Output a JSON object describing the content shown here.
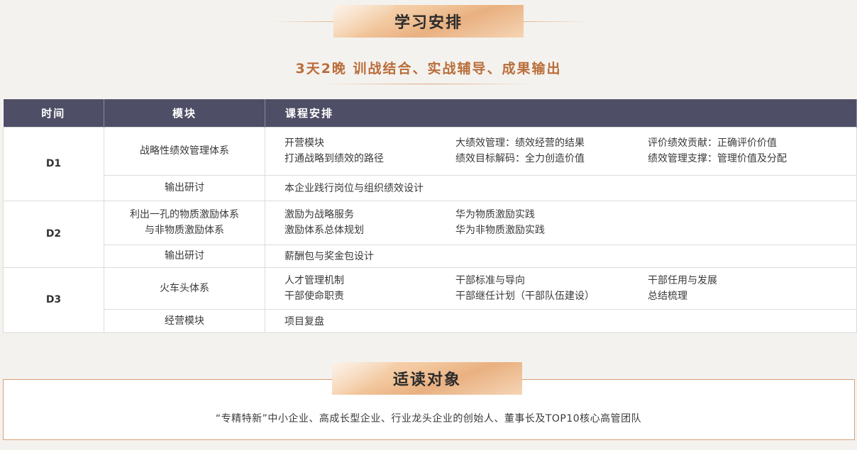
{
  "arrangement": {
    "title": "学习安排",
    "subtitle": "3天2晚 训战结合、实战辅导、成果输出"
  },
  "table": {
    "headers": {
      "time": "时间",
      "module": "模块",
      "course": "课程安排"
    },
    "days": [
      {
        "label": "D1",
        "rows": [
          {
            "module": [
              "战略性绩效管理体系"
            ],
            "items": [
              "开营模块",
              "大绩效管理：绩效经营的结果",
              "评价绩效贡献：正确评价价值",
              "打通战略到绩效的路径",
              "绩效目标解码：全力创造价值",
              "绩效管理支撑：管理价值及分配"
            ]
          },
          {
            "module": [
              "输出研讨"
            ],
            "items": [
              "本企业践行岗位与组织绩效设计"
            ]
          }
        ]
      },
      {
        "label": "D2",
        "rows": [
          {
            "module": [
              "利出一孔的物质激励体系",
              "与非物质激励体系"
            ],
            "items": [
              "激励为战略服务",
              "华为物质激励实践",
              "",
              "激励体系总体规划",
              "华为非物质激励实践",
              ""
            ]
          },
          {
            "module": [
              "输出研讨"
            ],
            "items": [
              "薪酬包与奖金包设计"
            ]
          }
        ]
      },
      {
        "label": "D3",
        "rows": [
          {
            "module": [
              "火车头体系"
            ],
            "items": [
              "人才管理机制",
              "干部标准与导向",
              "干部任用与发展",
              "干部使命职责",
              "干部继任计划（干部队伍建设）",
              "总结梳理"
            ]
          },
          {
            "module": [
              "经营模块"
            ],
            "items": [
              "项目复盘"
            ]
          }
        ]
      }
    ]
  },
  "audience": {
    "title": "适读对象",
    "text": "“专精特新”中小企业、高成长型企业、行业龙头企业的创始人、董事长及TOP10核心高管团队"
  }
}
